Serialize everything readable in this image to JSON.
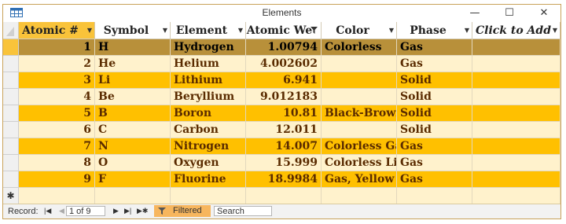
{
  "window": {
    "title": "Elements",
    "minimize": "—",
    "maximize": "☐",
    "close": "✕"
  },
  "columns": [
    {
      "label": "Atomic #"
    },
    {
      "label": "Symbol"
    },
    {
      "label": "Element"
    },
    {
      "label": "Atomic We"
    },
    {
      "label": "Color"
    },
    {
      "label": "Phase"
    },
    {
      "label": "Click to Add"
    }
  ],
  "rows": [
    {
      "num": "1",
      "symbol": "H",
      "element": "Hydrogen",
      "weight": "1.00794",
      "color": "Colorless",
      "phase": "Gas"
    },
    {
      "num": "2",
      "symbol": "He",
      "element": "Helium",
      "weight": "4.002602",
      "color": "",
      "phase": "Gas"
    },
    {
      "num": "3",
      "symbol": "Li",
      "element": "Lithium",
      "weight": "6.941",
      "color": "",
      "phase": "Solid"
    },
    {
      "num": "4",
      "symbol": "Be",
      "element": "Beryllium",
      "weight": "9.012183",
      "color": "",
      "phase": "Solid"
    },
    {
      "num": "5",
      "symbol": "B",
      "element": "Boron",
      "weight": "10.81",
      "color": "Black-Brown",
      "phase": "Solid"
    },
    {
      "num": "6",
      "symbol": "C",
      "element": "Carbon",
      "weight": "12.011",
      "color": "",
      "phase": "Solid"
    },
    {
      "num": "7",
      "symbol": "N",
      "element": "Nitrogen",
      "weight": "14.007",
      "color": "Colorless Ga",
      "phase": "Gas"
    },
    {
      "num": "8",
      "symbol": "O",
      "element": "Oxygen",
      "weight": "15.999",
      "color": "Colorless Liq",
      "phase": "Gas"
    },
    {
      "num": "9",
      "symbol": "F",
      "element": "Fluorine",
      "weight": "18.9984",
      "color": "Gas, Yellow",
      "phase": "Gas"
    }
  ],
  "new_row_marker": "✱",
  "statusbar": {
    "record_label": "Record:",
    "record_value": "1 of 9",
    "filtered_label": "Filtered",
    "search_label": "Search"
  },
  "colors": {
    "row_alt_a": "#ffc000",
    "row_alt_b": "#fff2cc",
    "row_selected": "#b8903a",
    "header_selected": "#f9c33a"
  },
  "icons": [
    "table-icon",
    "filter-icon",
    "first-record-icon",
    "previous-record-icon",
    "next-record-icon",
    "last-record-icon",
    "new-record-icon"
  ]
}
